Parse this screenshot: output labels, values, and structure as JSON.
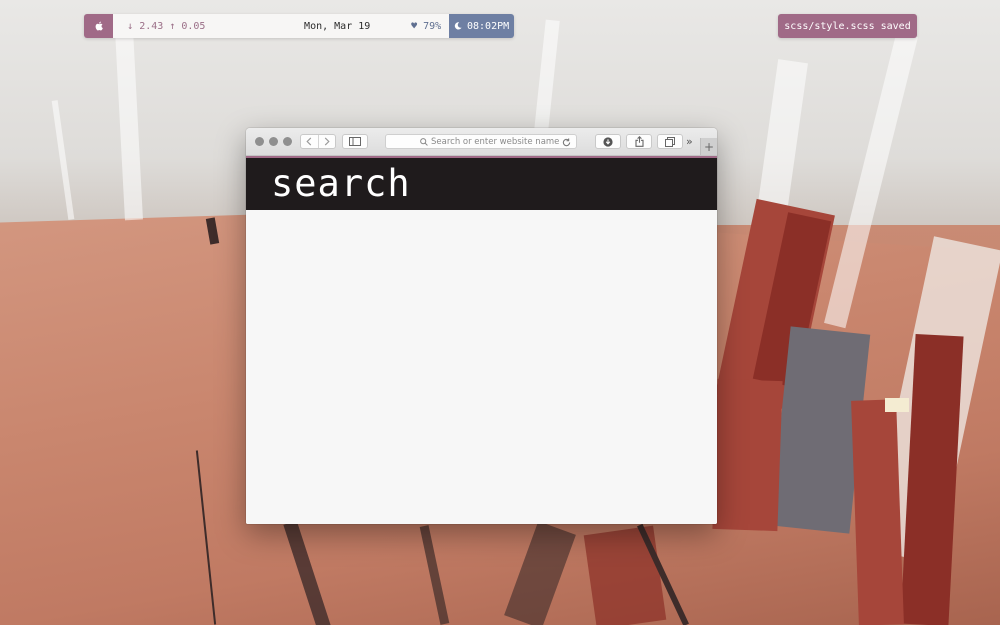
{
  "topbar": {
    "apple_icon": "apple-logo-icon",
    "network": "↓ 2.43 ↑ 0.05",
    "date": "Mon, Mar 19",
    "battery": "♥ 79%",
    "time_icon": "moon-icon",
    "time": "08:02PM"
  },
  "status_pill": {
    "text": "scss/style.scss saved"
  },
  "browser": {
    "url_placeholder": "Search or enter website name",
    "icons": {
      "back": "chevron-left-icon",
      "forward": "chevron-right-icon",
      "sidebar": "sidebar-icon",
      "search": "search-icon",
      "reload": "reload-icon",
      "download": "download-icon",
      "share": "share-icon",
      "tabs": "tabs-icon",
      "more": "double-chevron-icon",
      "new_tab": "plus-icon"
    },
    "new_tab_label": "+",
    "more_label": "»",
    "page": {
      "heading": "search"
    }
  },
  "colors": {
    "accent_mauve": "#a06a87",
    "accent_blue": "#6e7fa3",
    "hero_background": "#1f1b1c"
  }
}
